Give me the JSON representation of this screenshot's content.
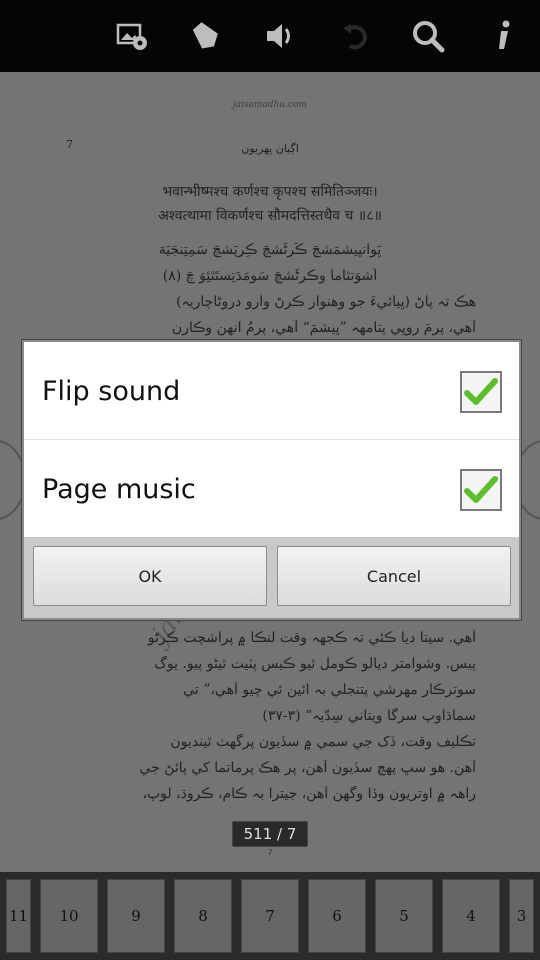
{
  "toolbar": {
    "icons": [
      "gallery-settings-icon",
      "bookmark-icon",
      "volume-icon",
      "undo-icon",
      "search-icon",
      "info-icon"
    ]
  },
  "page": {
    "url": "jaisamadhu.com",
    "page_number": "7",
    "header": "اڳيان پهريون",
    "lines": [
      {
        "text": "भवान्भीष्मश्च कर्णश्च कृपश्च समितिञ्जयः।",
        "dir": "ltr"
      },
      {
        "text": "अश्वत्थामा विकर्णश्च सौमदत्तिस्तथैव च ॥८॥",
        "dir": "ltr"
      },
      {
        "text": "ڀَوانڀِيشمَشچَ ڪَرڻَشچَ ڪِرپَشچَ سَمِتِنجَيَهَ",
        "dir": "rtl"
      },
      {
        "text": "اَشوَتٿاما وِڪرڻَشچَ سَومَدَتِستَٿئِوَ چَ (٨)",
        "dir": "rtl"
      },
      {
        "text": "هڪ تہ پاڻ (ڀيائيءَ جو وهنوار ڪرڻ وارو دروڻاچاريہ)",
        "dir": "rtl"
      },
      {
        "text": "آهي، پرمَ روڀي پتامهہ ”ڀيشمَ“ آهي، پرمُ انهن وڪارن",
        "dir": "rtl"
      },
      {
        "text": "آهي. سيتا ديا ڪئي تہ ڪجهہ وقت لنڪا ۾ پراشچت ڪرڻو",
        "dir": "rtl"
      },
      {
        "text": "پيس. وشوامتر ديالو ڪومل ٿيو ڪيس پٽيت ٿيڻو پيو. يوگ",
        "dir": "rtl"
      },
      {
        "text": "سوترڪار مهرشي پتنجلي بہ ائين ئي چيو آهي،” تي",
        "dir": "rtl"
      },
      {
        "text": "سماڌاوِپ سرگا وِيتاني سِدّيہ“ (٣-٣٧)",
        "dir": "rtl"
      },
      {
        "text": "تڪليف وقت، ڏک جي سمي ۾ سڏيون پرگهٽ ٿينديون",
        "dir": "rtl"
      },
      {
        "text": "آهن. هو سڀ پهچ سڏيون آهن، پر هڪ پرماتما کي پائڻ جي",
        "dir": "rtl"
      },
      {
        "text": "راهہ ۾ اوتريون وڏا وگهن آهن، جيترا بہ ڪام، ڪروڌ، لوڀ،",
        "dir": "rtl"
      }
    ],
    "watermark": "jaisam",
    "indicator": "511 / 7",
    "indicator_sub": "7"
  },
  "thumbnails": [
    "11",
    "10",
    "9",
    "8",
    "7",
    "6",
    "5",
    "4",
    "3"
  ],
  "dialog": {
    "options": [
      {
        "label": "Flip sound",
        "checked": true
      },
      {
        "label": "Page music",
        "checked": true
      }
    ],
    "ok_label": "OK",
    "cancel_label": "Cancel"
  },
  "colors": {
    "check_green": "#5cbf2a",
    "toolbar_bg": "#050505",
    "dialog_bg": "#ffffff"
  }
}
